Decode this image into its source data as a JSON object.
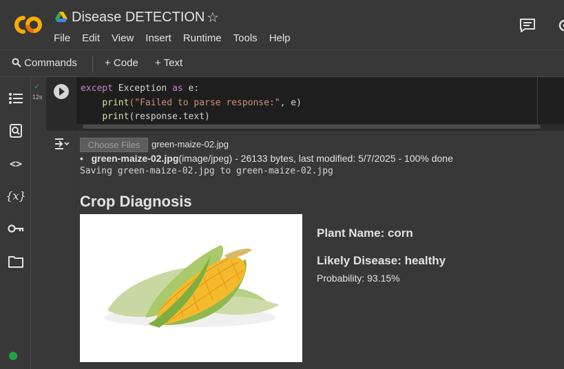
{
  "app": {
    "title": "Disease DETECTION",
    "logo_text": "CO"
  },
  "menu": [
    "File",
    "Edit",
    "View",
    "Insert",
    "Runtime",
    "Tools",
    "Help"
  ],
  "toolbar": {
    "commands_label": "Commands",
    "code_label": "+ Code",
    "text_label": "+ Text"
  },
  "sidebar": {
    "icons": [
      "table-of-contents-icon",
      "find-replace-icon",
      "code-snippets-icon",
      "variables-icon",
      "secrets-key-icon",
      "files-folder-icon"
    ],
    "variables_glyph": "{x}",
    "code_glyph": "<>"
  },
  "cell": {
    "exec_time": "12s",
    "code_lines": [
      {
        "kw": "except",
        "rest": " Exception ",
        "kw2": "as",
        "rest2": " e:"
      },
      {
        "indent": "    ",
        "fn": "print",
        "str": "(\"Failed to parse response:\"",
        "rest": ", e)"
      },
      {
        "indent": "    ",
        "fn": "print",
        "rest": "(response.text)"
      }
    ]
  },
  "output": {
    "choose_files_label": "Choose Files",
    "chosen_file": "green-maize-02.jpg",
    "file_bold": "green-maize-02.jpg",
    "file_detail": "(image/jpeg) - 26133 bytes, last modified: 5/7/2025 - 100% done",
    "saving_text": "Saving green-maize-02.jpg to green-maize-02.jpg",
    "heading": "Crop Diagnosis",
    "plant_name": "Plant Name: corn",
    "likely_disease": "Likely Disease: healthy",
    "probability": "Probability: 93.15%"
  },
  "colors": {
    "background": "#383838",
    "code_bg": "#1e1e1e",
    "logo_orange": "#f9ab00",
    "status_green": "#1ea446",
    "keyword": "#c586c0",
    "function": "#dcdcaa",
    "string": "#ce9178"
  }
}
